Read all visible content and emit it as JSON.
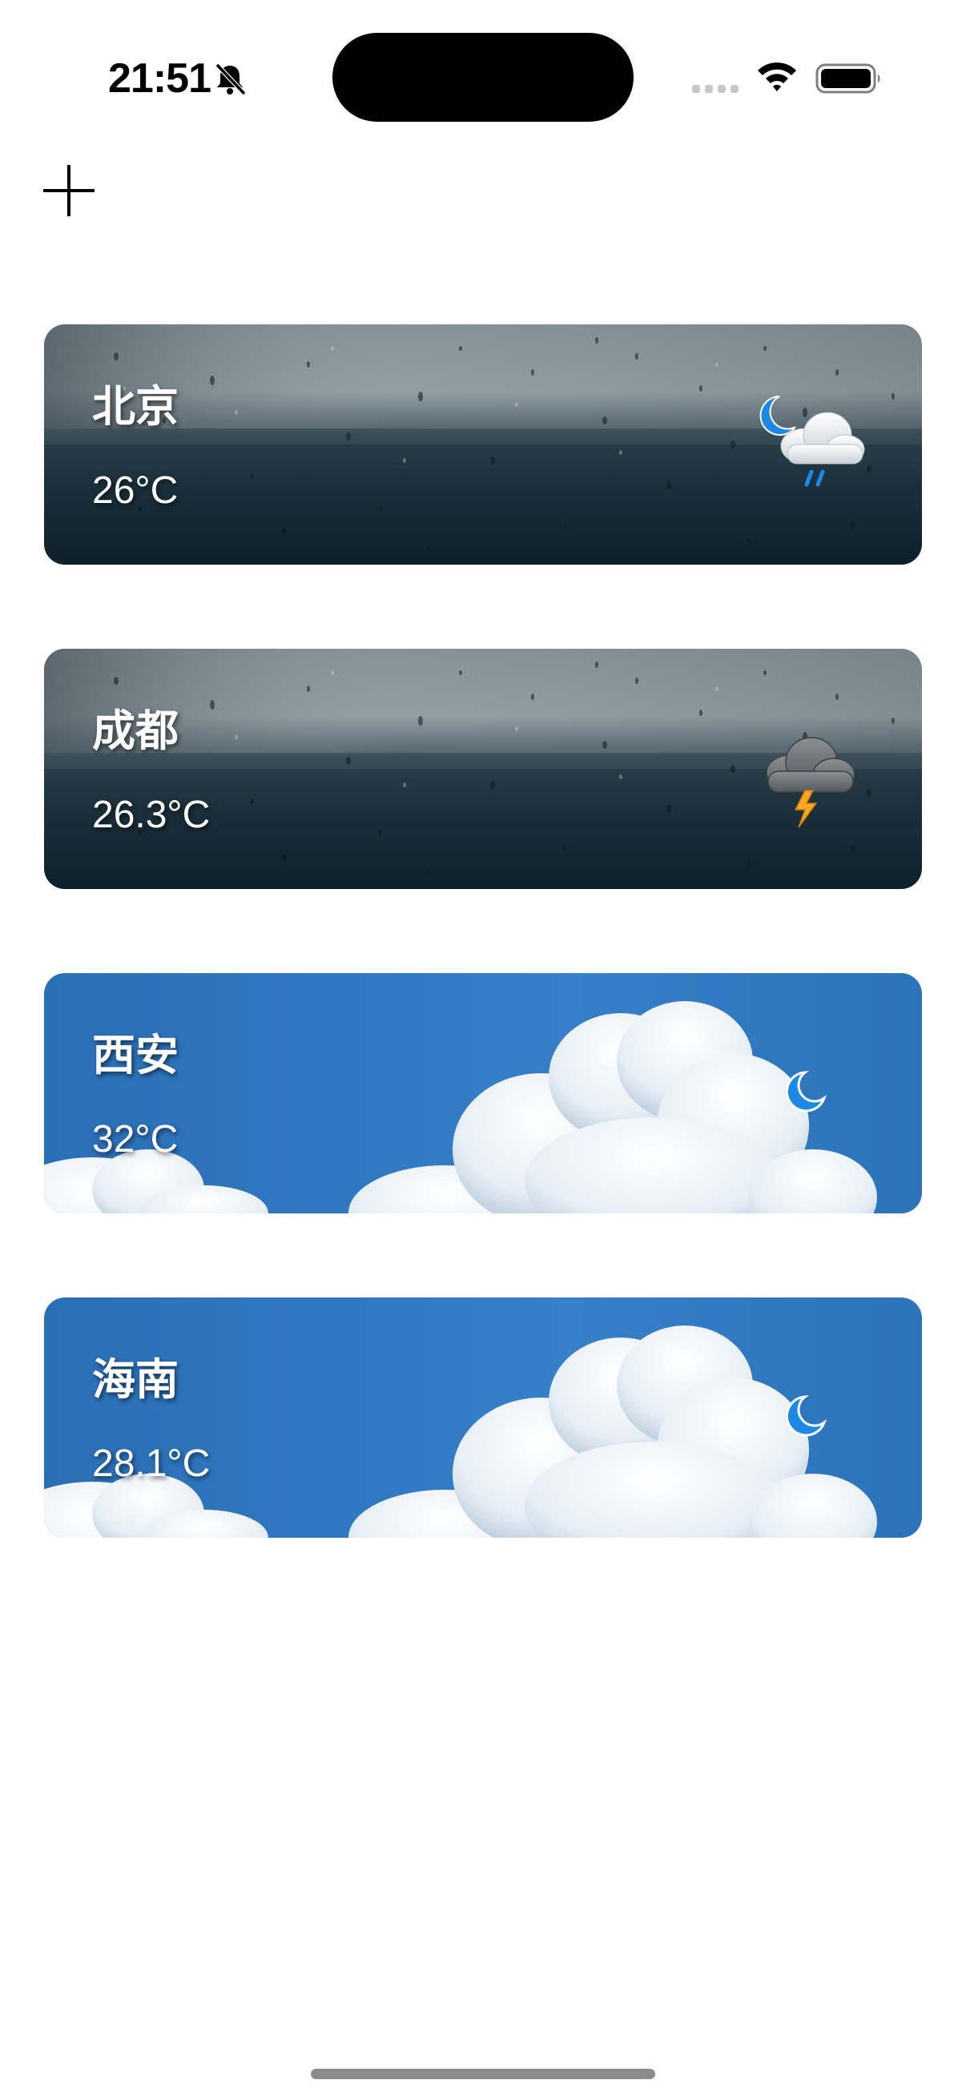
{
  "status_bar": {
    "time": "21:51",
    "silent_icon": "bell-slash-icon",
    "signal_icon": "cellular-signal-icon",
    "wifi_icon": "wifi-icon",
    "battery_icon": "battery-icon"
  },
  "toolbar": {
    "add_icon": "plus-icon"
  },
  "cities": [
    {
      "name": "北京",
      "temperature": "26°C",
      "background": "rain-window",
      "weather_icon": "night-rain-cloud-icon"
    },
    {
      "name": "成都",
      "temperature": "26.3°C",
      "background": "rain-window",
      "weather_icon": "thunderstorm-icon"
    },
    {
      "name": "西安",
      "temperature": "32°C",
      "background": "blue-sky-clouds",
      "weather_icon": "crescent-moon-icon"
    },
    {
      "name": "海南",
      "temperature": "28.1°C",
      "background": "blue-sky-clouds",
      "weather_icon": "crescent-moon-icon"
    }
  ],
  "colors": {
    "moon": "#1E88E5",
    "lightning": "#F9A825",
    "rain": "#1E88E5",
    "sky": "#2F7BC4"
  }
}
